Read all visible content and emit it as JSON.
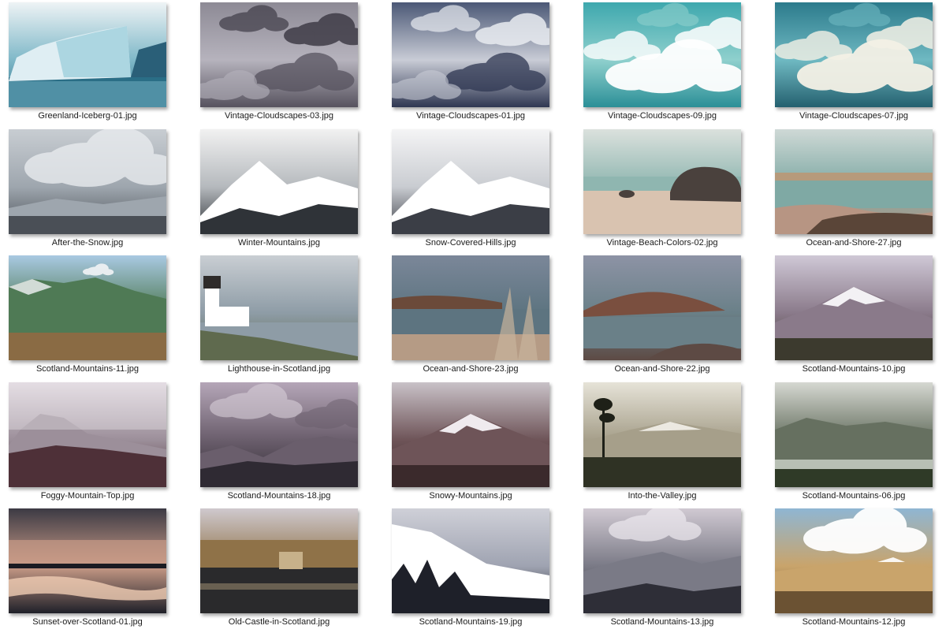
{
  "files": [
    {
      "name": "Greenland-Iceberg-01.jpg",
      "scene": "iceberg",
      "colors": {
        "top": "#eef3f5",
        "mid": "#7fb8c8",
        "bottom": "#2a6e86",
        "accent": "#ffffff"
      }
    },
    {
      "name": "Vintage-Cloudscapes-03.jpg",
      "scene": "clouds-dark",
      "colors": {
        "top": "#8d8a95",
        "mid": "#b6b3bd",
        "bottom": "#57535f",
        "accent": "#3f3c47"
      }
    },
    {
      "name": "Vintage-Cloudscapes-01.jpg",
      "scene": "clouds-dark",
      "colors": {
        "top": "#4b5876",
        "mid": "#c9ccd6",
        "bottom": "#2f3752",
        "accent": "#e9ecf1"
      }
    },
    {
      "name": "Vintage-Cloudscapes-09.jpg",
      "scene": "clouds-bright",
      "colors": {
        "top": "#3ea8ae",
        "mid": "#8fd0cd",
        "bottom": "#2b8f97",
        "accent": "#ffffff"
      }
    },
    {
      "name": "Vintage-Cloudscapes-07.jpg",
      "scene": "clouds-bright",
      "colors": {
        "top": "#2c7b8c",
        "mid": "#6fb9c2",
        "bottom": "#24606f",
        "accent": "#f4f1e6"
      }
    },
    {
      "name": "After-the-Snow.jpg",
      "scene": "snow-plain",
      "colors": {
        "top": "#c8cdd2",
        "mid": "#9ea6ae",
        "bottom": "#4a4f56",
        "accent": "#e8ebee"
      }
    },
    {
      "name": "Winter-Mountains.jpg",
      "scene": "snow-mountain",
      "colors": {
        "top": "#f1f1f1",
        "mid": "#b5b9bd",
        "bottom": "#2f3338",
        "accent": "#ffffff"
      }
    },
    {
      "name": "Snow-Covered-Hills.jpg",
      "scene": "snow-mountain",
      "colors": {
        "top": "#f4f4f5",
        "mid": "#c9ccd1",
        "bottom": "#3b3e46",
        "accent": "#ffffff"
      }
    },
    {
      "name": "Vintage-Beach-Colors-02.jpg",
      "scene": "beach-rock",
      "colors": {
        "top": "#dbe1dd",
        "mid": "#8fb6b0",
        "bottom": "#d9c3b0",
        "accent": "#4a413d"
      }
    },
    {
      "name": "Ocean-and-Shore-27.jpg",
      "scene": "shore",
      "colors": {
        "top": "#cfd9d6",
        "mid": "#7fa9a4",
        "bottom": "#b79583",
        "accent": "#5a4538"
      }
    },
    {
      "name": "Scotland-Mountains-11.jpg",
      "scene": "green-mountain",
      "colors": {
        "top": "#a9c9e2",
        "mid": "#4f7a55",
        "bottom": "#8a6b44",
        "accent": "#f2f4f6"
      }
    },
    {
      "name": "Lighthouse-in-Scotland.jpg",
      "scene": "lighthouse",
      "colors": {
        "top": "#c9ced3",
        "mid": "#8e9ca6",
        "bottom": "#5f6a4e",
        "accent": "#ffffff"
      }
    },
    {
      "name": "Ocean-and-Shore-23.jpg",
      "scene": "shore-grass",
      "colors": {
        "top": "#7b8799",
        "mid": "#5d7480",
        "bottom": "#b59b85",
        "accent": "#6b4a3a"
      }
    },
    {
      "name": "Ocean-and-Shore-22.jpg",
      "scene": "shore-rock",
      "colors": {
        "top": "#8d93a5",
        "mid": "#6a8088",
        "bottom": "#5d4a44",
        "accent": "#7a4f3f"
      }
    },
    {
      "name": "Scotland-Mountains-10.jpg",
      "scene": "snow-peak",
      "colors": {
        "top": "#cfc8d6",
        "mid": "#8a7a8a",
        "bottom": "#3c3a2e",
        "accent": "#f3f1f4"
      }
    },
    {
      "name": "Foggy-Mountain-Top.jpg",
      "scene": "foggy-mountain",
      "colors": {
        "top": "#ddd4dc",
        "mid": "#9c8f9a",
        "bottom": "#4e3038",
        "accent": "#f1edf0"
      }
    },
    {
      "name": "Scotland-Mountains-18.jpg",
      "scene": "dark-mountain",
      "colors": {
        "top": "#b5a6b8",
        "mid": "#6a5e6c",
        "bottom": "#2f2a33",
        "accent": "#d8cfd9"
      }
    },
    {
      "name": "Snowy-Mountains.jpg",
      "scene": "snow-peak",
      "colors": {
        "top": "#c9c2c8",
        "mid": "#6e5458",
        "bottom": "#3b2a2c",
        "accent": "#efeaee"
      }
    },
    {
      "name": "Into-the-Valley.jpg",
      "scene": "valley-tree",
      "colors": {
        "top": "#e6e3d8",
        "mid": "#a69f8a",
        "bottom": "#2f3224",
        "accent": "#f4f1ea"
      }
    },
    {
      "name": "Scotland-Mountains-06.jpg",
      "scene": "lake-mountain",
      "colors": {
        "top": "#d6d8d2",
        "mid": "#667060",
        "bottom": "#2f3a27",
        "accent": "#b8c0b4"
      }
    },
    {
      "name": "Sunset-over-Scotland-01.jpg",
      "scene": "sunset-lake",
      "colors": {
        "top": "#3c3a44",
        "mid": "#c99b87",
        "bottom": "#1f2029",
        "accent": "#f0cdb4"
      }
    },
    {
      "name": "Old-Castle-in-Scotland.jpg",
      "scene": "castle-lake",
      "colors": {
        "top": "#cfc9ce",
        "mid": "#8f7248",
        "bottom": "#2a2a2c",
        "accent": "#c7b18a"
      }
    },
    {
      "name": "Scotland-Mountains-19.jpg",
      "scene": "snow-forest",
      "colors": {
        "top": "#cfd0d8",
        "mid": "#9fa3b1",
        "bottom": "#1e2029",
        "accent": "#ffffff"
      }
    },
    {
      "name": "Scotland-Mountains-13.jpg",
      "scene": "mist-mountain",
      "colors": {
        "top": "#d0c9d2",
        "mid": "#7a7a86",
        "bottom": "#2e2e37",
        "accent": "#eeeaf0"
      }
    },
    {
      "name": "Scotland-Mountains-12.jpg",
      "scene": "sunny-valley",
      "colors": {
        "top": "#8fb6d3",
        "mid": "#c9a46b",
        "bottom": "#6b5233",
        "accent": "#ffffff"
      }
    }
  ]
}
